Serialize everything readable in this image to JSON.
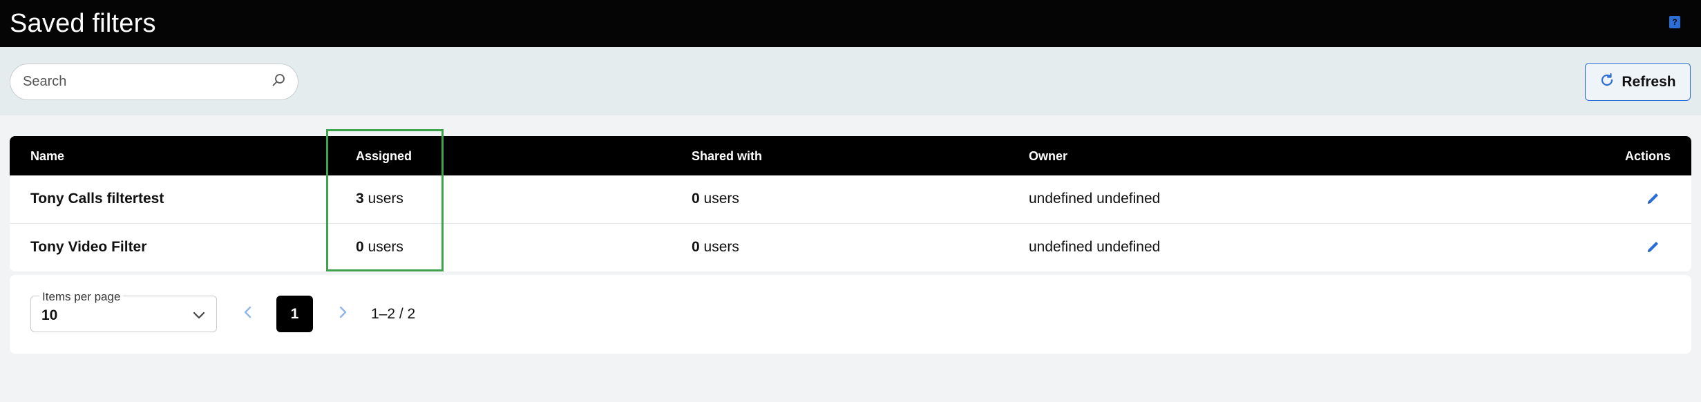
{
  "header": {
    "title": "Saved filters",
    "help_icon": "help-book-icon"
  },
  "toolbar": {
    "search_placeholder": "Search",
    "search_value": "",
    "refresh_label": "Refresh"
  },
  "table": {
    "columns": [
      "Name",
      "Assigned",
      "Shared with",
      "Owner",
      "Actions"
    ],
    "rows": [
      {
        "name": "Tony Calls filtertest",
        "assigned_count": "3",
        "assigned_unit": "users",
        "shared_count": "0",
        "shared_unit": "users",
        "owner": "undefined undefined"
      },
      {
        "name": "Tony Video Filter",
        "assigned_count": "0",
        "assigned_unit": "users",
        "shared_count": "0",
        "shared_unit": "users",
        "owner": "undefined undefined"
      }
    ]
  },
  "pagination": {
    "items_per_page_label": "Items per page",
    "items_per_page_value": "10",
    "current_page": "1",
    "range": "1–2 / 2"
  },
  "colors": {
    "accent": "#2b6fd6",
    "highlight": "#3fa34d",
    "header_bg": "#050505"
  }
}
